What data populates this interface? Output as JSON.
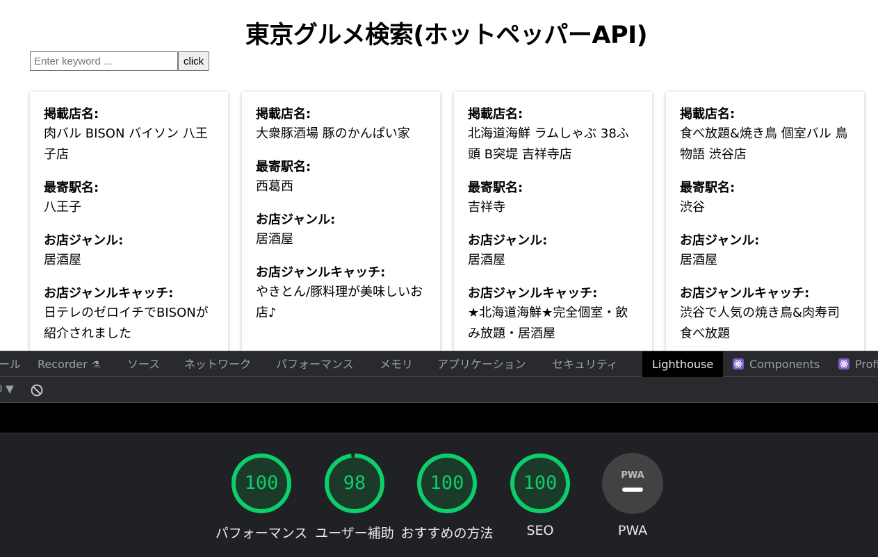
{
  "page": {
    "title": "東京グルメ検索(ホットペッパーAPI)",
    "search": {
      "placeholder": "Enter keyword ...",
      "button_label": "click"
    },
    "labels": {
      "shop_name": "掲載店名:",
      "station": "最寄駅名:",
      "genre": "お店ジャンル:",
      "genre_catch": "お店ジャンルキャッチ:"
    },
    "cards": [
      {
        "shop_name": "肉バル BISON バイソン 八王子店",
        "station": "八王子",
        "genre": "居酒屋",
        "genre_catch": "日テレのゼロイチでBISONが紹介されました"
      },
      {
        "shop_name": "大衆豚酒場 豚のかんぱい家",
        "station": "西葛西",
        "genre": "居酒屋",
        "genre_catch": "やきとん/豚料理が美味しいお店♪"
      },
      {
        "shop_name": "北海道海鮮 ラムしゃぶ 38ふ頭 B突堤 吉祥寺店",
        "station": "吉祥寺",
        "genre": "居酒屋",
        "genre_catch": "★北海道海鮮★完全個室・飲み放題・居酒屋"
      },
      {
        "shop_name": "食べ放題&焼き鳥 個室バル 鳥物語 渋谷店",
        "station": "渋谷",
        "genre": "居酒屋",
        "genre_catch": "渋谷で人気の焼き鳥&肉寿司食べ放題"
      }
    ]
  },
  "devtools": {
    "tabs": [
      {
        "label": "ール",
        "icon": ""
      },
      {
        "label": "Recorder",
        "icon": "flask-icon"
      },
      {
        "label": "ソース",
        "icon": ""
      },
      {
        "label": "ネットワーク",
        "icon": ""
      },
      {
        "label": "パフォーマンス",
        "icon": ""
      },
      {
        "label": "メモリ",
        "icon": ""
      },
      {
        "label": "アプリケーション",
        "icon": ""
      },
      {
        "label": "セキュリティ",
        "icon": ""
      },
      {
        "label": "Lighthouse",
        "icon": "",
        "active": true
      },
      {
        "label": "Components",
        "icon": "react-icon"
      },
      {
        "label": "Profi",
        "icon": "react-icon"
      }
    ],
    "toolbar": {
      "count": "0 ▼"
    },
    "scores": [
      {
        "label": "パフォーマンス",
        "score": 100,
        "display": "100"
      },
      {
        "label": "ユーザー補助",
        "score": 98,
        "display": "98"
      },
      {
        "label": "おすすめの方法",
        "score": 100,
        "display": "100"
      },
      {
        "label": "SEO",
        "score": 100,
        "display": "100"
      },
      {
        "label": "PWA",
        "score": null,
        "display": "PWA"
      }
    ],
    "colors": {
      "pass": "#0cce6b",
      "pass_fill": "#1c3a2a",
      "pwa_bg": "#424242"
    }
  }
}
